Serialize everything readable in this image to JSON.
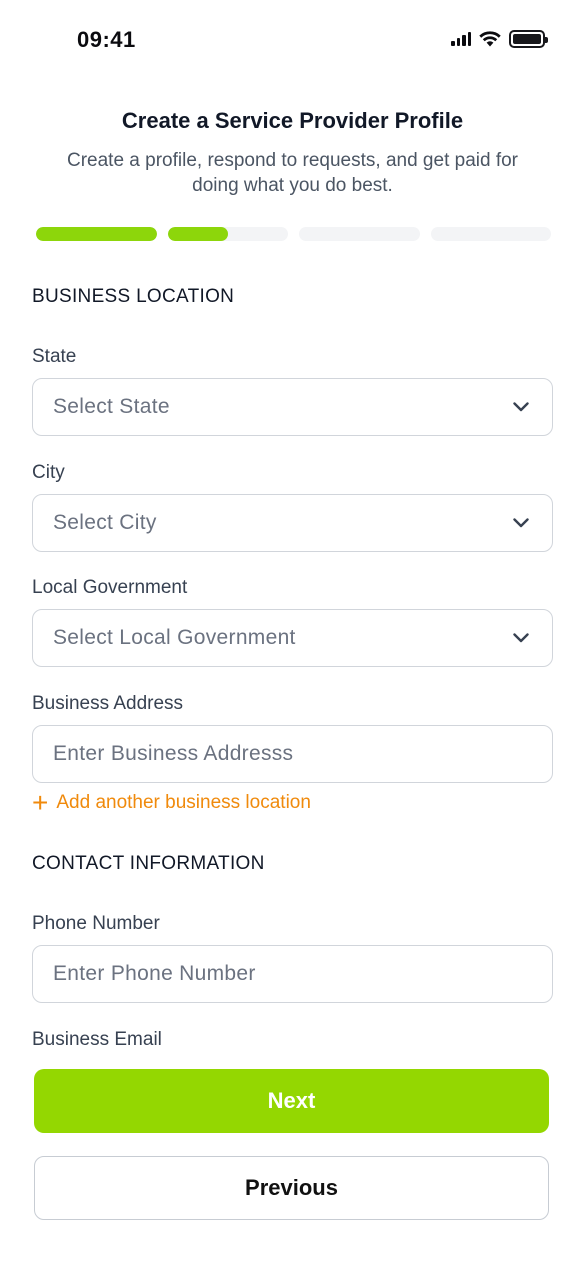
{
  "status_bar": {
    "time": "09:41",
    "icons": [
      "cellular-signal-icon",
      "wifi-icon",
      "battery-icon"
    ]
  },
  "header": {
    "title": "Create a Service Provider Profile",
    "subtitle": "Create a profile, respond to requests, and get paid for doing what you do best."
  },
  "progress": {
    "steps": 4,
    "step_fill": [
      1.0,
      0.5,
      0.0,
      0.0
    ]
  },
  "business_location": {
    "heading": "BUSINESS LOCATION",
    "state": {
      "label": "State",
      "placeholder": "Select State"
    },
    "city": {
      "label": "City",
      "placeholder": "Select City"
    },
    "local_government": {
      "label": "Local Government",
      "placeholder": "Select Local Government"
    },
    "address": {
      "label": "Business Address",
      "placeholder": "Enter Business Addresss"
    },
    "add_location_label": "Add another business location"
  },
  "contact_information": {
    "heading": "CONTACT INFORMATION",
    "phone": {
      "label": "Phone Number",
      "placeholder": "Enter Phone Number"
    },
    "email": {
      "label": "Business Email"
    }
  },
  "actions": {
    "next_label": "Next",
    "previous_label": "Previous"
  },
  "colors": {
    "accent_green": "#94d701",
    "progress_green": "#8dd60b",
    "link_orange": "#f08a0c",
    "border_gray": "#d1d5db"
  }
}
